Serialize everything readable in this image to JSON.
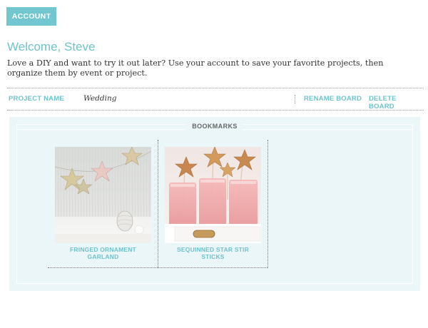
{
  "header": {
    "account_label": "ACCOUNT"
  },
  "welcome": {
    "title": "Welcome, Steve",
    "intro": "Love a DIY and want to try it out later? Use your account to save your favorite projects, then organize them by event or project."
  },
  "project_bar": {
    "label": "PROJECT NAME",
    "value": "Wedding",
    "rename_label": "RENAME BOARD",
    "delete_label": "DELETE BOARD"
  },
  "board": {
    "title": "BOOKMARKS",
    "items": [
      {
        "title": "FRINGED ORNAMENT GARLAND"
      },
      {
        "title": "SEQUINNED STAR STIR STICKS"
      }
    ]
  },
  "colors": {
    "accent": "#72c6cf",
    "board_bg": "#eaf6f8"
  }
}
